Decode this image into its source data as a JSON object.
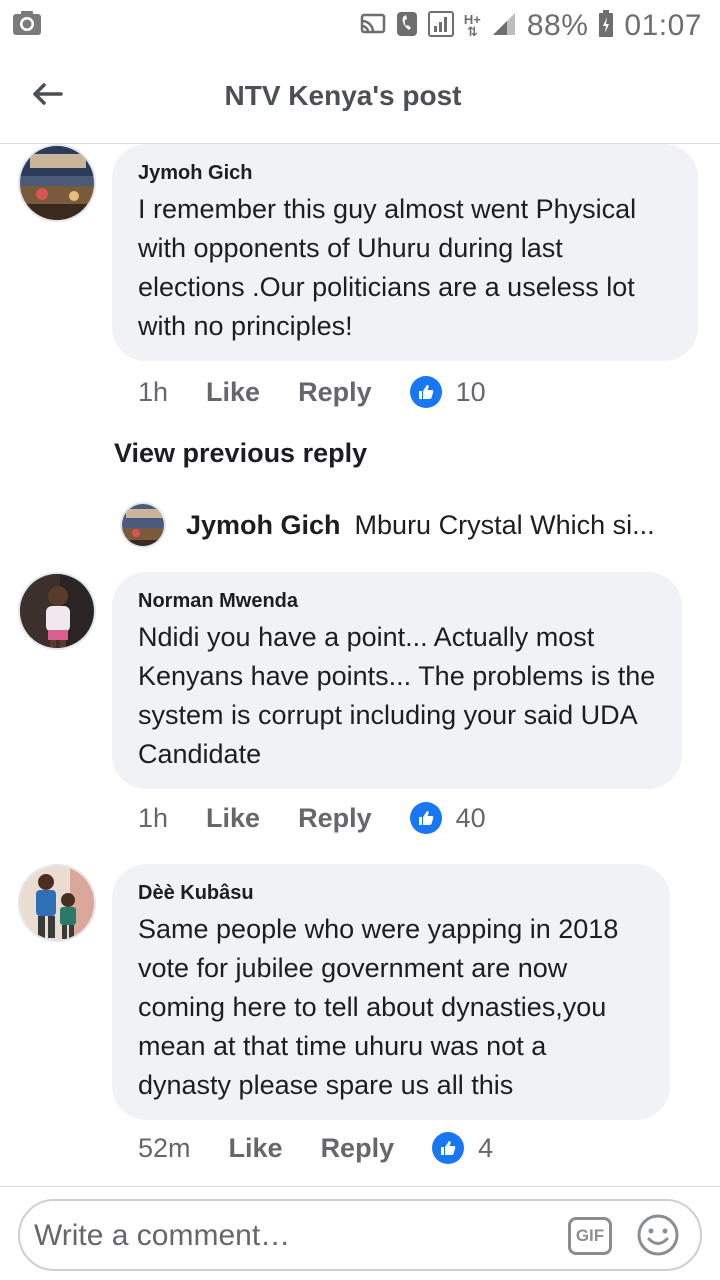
{
  "status_bar": {
    "battery": "88%",
    "time": "01:07",
    "network": "H+"
  },
  "header": {
    "title": "NTV Kenya's post"
  },
  "comments": [
    {
      "name": "Jymoh Gich",
      "text": "I remember this guy almost went Physical with opponents of Uhuru during last elections .Our politicians are a useless lot with no principles!",
      "time": "1h",
      "like_label": "Like",
      "reply_label": "Reply",
      "likes": "10"
    },
    {
      "name": "Norman Mwenda",
      "text": "Ndidi you have a point... Actually most Kenyans have points... The problems is the system is corrupt including your said UDA Candidate",
      "time": "1h",
      "like_label": "Like",
      "reply_label": "Reply",
      "likes": "40"
    },
    {
      "name": "Dèè Kubâsu",
      "text": "Same people who were yapping in 2018 vote for jubilee government are now coming here to tell about dynasties,you mean at that time uhuru was not a dynasty please spare us all this",
      "time": "52m",
      "like_label": "Like",
      "reply_label": "Reply",
      "likes": "4"
    }
  ],
  "view_previous": "View previous reply",
  "reply_preview": {
    "name": "Jymoh Gich",
    "text": "Mburu Crystal Which si..."
  },
  "composer": {
    "placeholder": "Write a comment…",
    "gif_label": "GIF"
  },
  "colors": {
    "like_blue": "#1877f2",
    "bubble_bg": "#f0f2f5",
    "secondary_text": "#65676b"
  }
}
